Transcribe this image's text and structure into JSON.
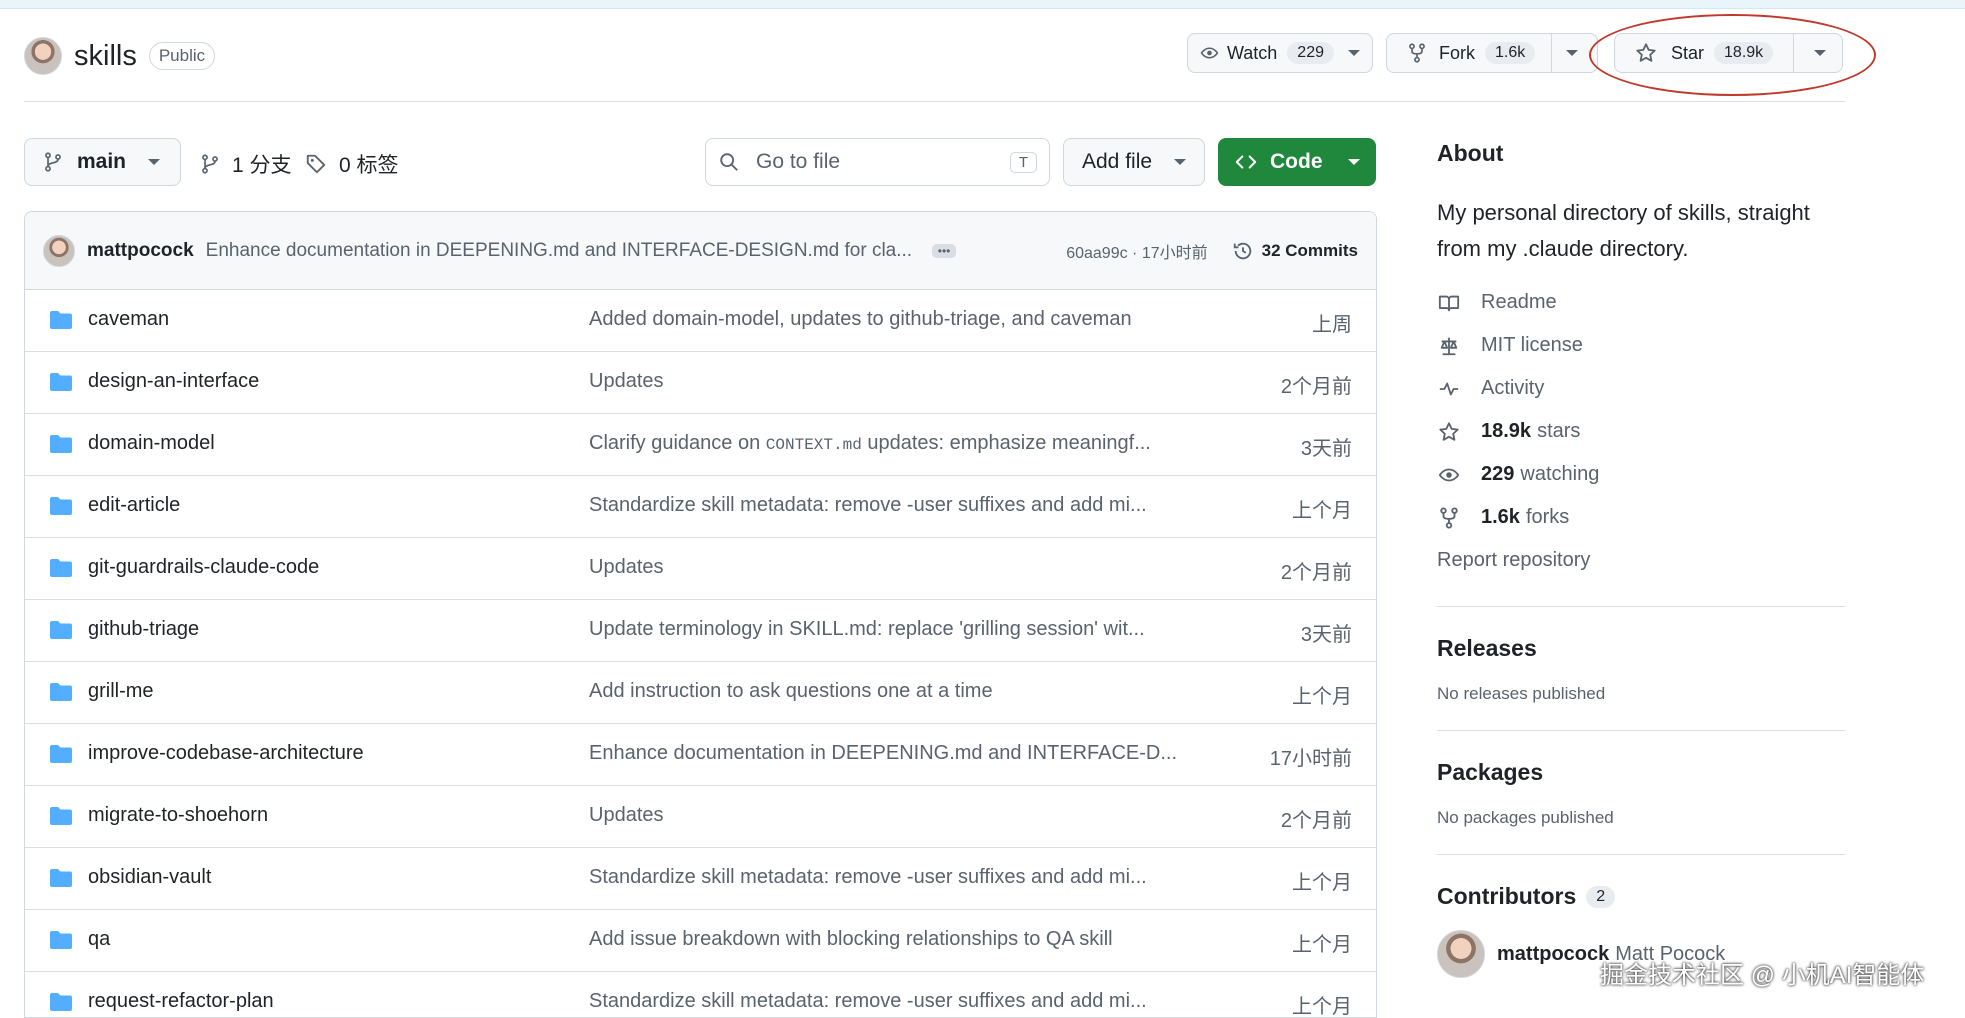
{
  "repo": {
    "name": "skills",
    "visibility": "Public"
  },
  "actions": {
    "watch": {
      "label": "Watch",
      "count": "229"
    },
    "fork": {
      "label": "Fork",
      "count": "1.6k"
    },
    "star": {
      "label": "Star",
      "count": "18.9k"
    }
  },
  "toolbar": {
    "branch": "main",
    "branches": "1 分支",
    "tags": "0 标签",
    "search_placeholder": "Go to file",
    "search_shortcut": "T",
    "add_file": "Add file",
    "code": "Code"
  },
  "latest_commit": {
    "author": "mattpocock",
    "message": "Enhance documentation in DEEPENING.md and INTERFACE-DESIGN.md for cla...",
    "sha_time": "60aa99c · 17小时前",
    "commits": "32 Commits"
  },
  "files": [
    {
      "name": "caveman",
      "msg": "Added domain-model, updates to github-triage, and caveman",
      "age": "上周"
    },
    {
      "name": "design-an-interface",
      "msg": "Updates",
      "age": "2个月前"
    },
    {
      "name": "domain-model",
      "msg_pre": "Clarify guidance on ",
      "msg_code": "CONTEXT.md",
      "msg_post": " updates: emphasize meaningf...",
      "age": "3天前"
    },
    {
      "name": "edit-article",
      "msg": "Standardize skill metadata: remove -user suffixes and add mi...",
      "age": "上个月"
    },
    {
      "name": "git-guardrails-claude-code",
      "msg": "Updates",
      "age": "2个月前"
    },
    {
      "name": "github-triage",
      "msg": "Update terminology in SKILL.md: replace 'grilling session' wit...",
      "age": "3天前"
    },
    {
      "name": "grill-me",
      "msg": "Add instruction to ask questions one at a time",
      "age": "上个月"
    },
    {
      "name": "improve-codebase-architecture",
      "msg": "Enhance documentation in DEEPENING.md and INTERFACE-D...",
      "age": "17小时前"
    },
    {
      "name": "migrate-to-shoehorn",
      "msg": "Updates",
      "age": "2个月前"
    },
    {
      "name": "obsidian-vault",
      "msg": "Standardize skill metadata: remove -user suffixes and add mi...",
      "age": "上个月"
    },
    {
      "name": "qa",
      "msg": "Add issue breakdown with blocking relationships to QA skill",
      "age": "上个月"
    },
    {
      "name": "request-refactor-plan",
      "msg": "Standardize skill metadata: remove -user suffixes and add mi...",
      "age": "上个月"
    }
  ],
  "about": {
    "title": "About",
    "description": "My personal directory of skills, straight from my .claude directory.",
    "readme": "Readme",
    "license": "MIT license",
    "activity": "Activity",
    "stars_count": "18.9k",
    "stars_label": "stars",
    "watching_count": "229",
    "watching_label": "watching",
    "forks_count": "1.6k",
    "forks_label": "forks",
    "report": "Report repository"
  },
  "releases": {
    "title": "Releases",
    "text": "No releases published"
  },
  "packages": {
    "title": "Packages",
    "text": "No packages published"
  },
  "contributors": {
    "title": "Contributors",
    "count": "2",
    "user": "mattpocock",
    "full_name": "Matt Pocock"
  },
  "watermark": "掘金技术社区 @ 小机AI智能体",
  "colors": {
    "accent_green": "#1f883d",
    "folder_blue": "#54aeff",
    "annotation_red": "#c0392b"
  }
}
